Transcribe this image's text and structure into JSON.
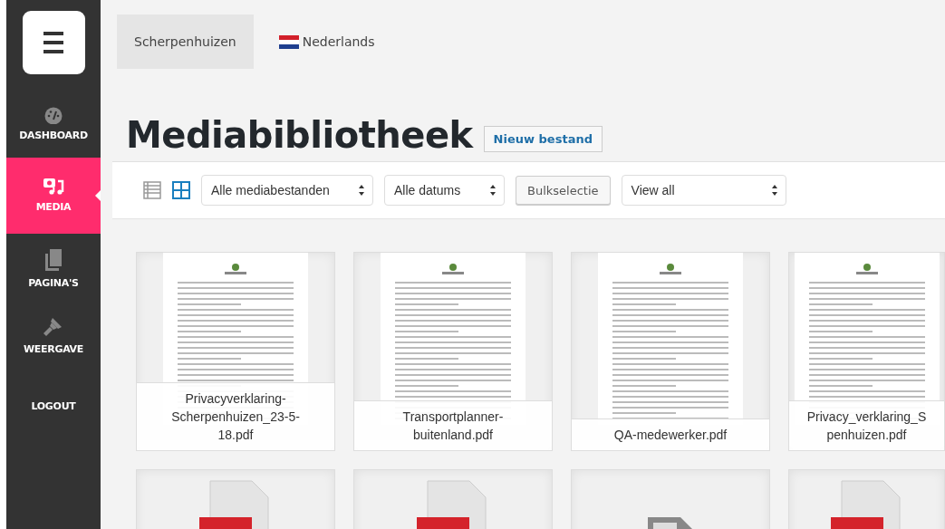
{
  "sidebar": {
    "items": [
      {
        "kind": "gauge",
        "label": "DASHBOARD",
        "selected": false
      },
      {
        "kind": "media",
        "label": "MEDIA",
        "selected": true
      },
      {
        "kind": "pages",
        "label": "PAGINA'S",
        "selected": false
      },
      {
        "kind": "brush",
        "label": "WEERGAVE",
        "selected": false
      },
      {
        "kind": "text",
        "label": "LOGOUT",
        "selected": false
      }
    ]
  },
  "topbar": {
    "items": [
      {
        "kind": "site",
        "label": "Scherpenhuizen",
        "selected": true
      },
      {
        "kind": "language",
        "label": "Nederlands",
        "selected": false
      }
    ]
  },
  "title": "Mediabibliotheek",
  "add_button": "Nieuw bestand",
  "toolbar": {
    "views": [
      {
        "kind": "list",
        "selected": false
      },
      {
        "kind": "grid",
        "selected": true
      }
    ],
    "type_filter": "Alle mediabestanden",
    "date_filter": "Alle datums",
    "bulk_button": "Bulkselectie",
    "view_filter": "View all"
  },
  "media": [
    {
      "kind": "preview",
      "caption_lines": [
        "Privacyverklaring-",
        "Scherpenhuizen_23-5-",
        "18.pdf"
      ]
    },
    {
      "kind": "preview",
      "caption_lines": [
        "Transportplanner-",
        "buitenland.pdf"
      ]
    },
    {
      "kind": "preview",
      "caption_lines": [
        "QA-medewerker.pdf"
      ]
    },
    {
      "kind": "preview",
      "caption_lines": [
        "Privacy_verklaring_S",
        "penhuizen.pdf"
      ]
    },
    {
      "kind": "pdf"
    },
    {
      "kind": "pdf"
    },
    {
      "kind": "file"
    },
    {
      "kind": "pdf"
    }
  ]
}
